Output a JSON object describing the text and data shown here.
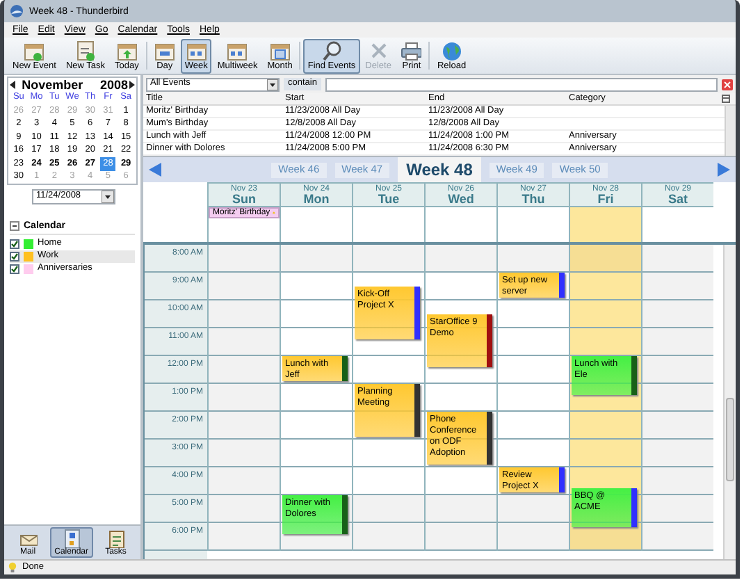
{
  "window": {
    "title": "Week 48 - Thunderbird"
  },
  "menu": [
    "File",
    "Edit",
    "View",
    "Go",
    "Calendar",
    "Tools",
    "Help"
  ],
  "toolbar": [
    {
      "label": "New Event",
      "selected": false,
      "disabled": false
    },
    {
      "label": "New Task",
      "selected": false,
      "disabled": false
    },
    {
      "label": "Today",
      "selected": false,
      "disabled": false
    },
    {
      "label": "Day",
      "selected": false,
      "disabled": false
    },
    {
      "label": "Week",
      "selected": true,
      "disabled": false
    },
    {
      "label": "Multiweek",
      "selected": false,
      "disabled": false
    },
    {
      "label": "Month",
      "selected": false,
      "disabled": false
    },
    {
      "label": "Find Events",
      "selected": true,
      "disabled": false
    },
    {
      "label": "Delete",
      "selected": false,
      "disabled": true
    },
    {
      "label": "Print",
      "selected": false,
      "disabled": false
    },
    {
      "label": "Reload",
      "selected": false,
      "disabled": false
    }
  ],
  "mini_calendar": {
    "month": "November",
    "year": "2008",
    "weekdays": [
      "Su",
      "Mo",
      "Tu",
      "We",
      "Th",
      "Fr",
      "Sa"
    ],
    "days": [
      {
        "label": "26",
        "other": true,
        "bold": false,
        "selected": false
      },
      {
        "label": "27",
        "other": true,
        "bold": false,
        "selected": false
      },
      {
        "label": "28",
        "other": true,
        "bold": false,
        "selected": false
      },
      {
        "label": "29",
        "other": true,
        "bold": false,
        "selected": false
      },
      {
        "label": "30",
        "other": true,
        "bold": false,
        "selected": false
      },
      {
        "label": "31",
        "other": true,
        "bold": false,
        "selected": false
      },
      {
        "label": "1",
        "other": false,
        "bold": false,
        "selected": false
      },
      {
        "label": "2",
        "other": false,
        "bold": false,
        "selected": false
      },
      {
        "label": "3",
        "other": false,
        "bold": false,
        "selected": false
      },
      {
        "label": "4",
        "other": false,
        "bold": false,
        "selected": false
      },
      {
        "label": "5",
        "other": false,
        "bold": false,
        "selected": false
      },
      {
        "label": "6",
        "other": false,
        "bold": false,
        "selected": false
      },
      {
        "label": "7",
        "other": false,
        "bold": false,
        "selected": false
      },
      {
        "label": "8",
        "other": false,
        "bold": false,
        "selected": false
      },
      {
        "label": "9",
        "other": false,
        "bold": false,
        "selected": false
      },
      {
        "label": "10",
        "other": false,
        "bold": false,
        "selected": false
      },
      {
        "label": "11",
        "other": false,
        "bold": false,
        "selected": false
      },
      {
        "label": "12",
        "other": false,
        "bold": false,
        "selected": false
      },
      {
        "label": "13",
        "other": false,
        "bold": false,
        "selected": false
      },
      {
        "label": "14",
        "other": false,
        "bold": false,
        "selected": false
      },
      {
        "label": "15",
        "other": false,
        "bold": false,
        "selected": false
      },
      {
        "label": "16",
        "other": false,
        "bold": false,
        "selected": false
      },
      {
        "label": "17",
        "other": false,
        "bold": false,
        "selected": false
      },
      {
        "label": "18",
        "other": false,
        "bold": false,
        "selected": false
      },
      {
        "label": "19",
        "other": false,
        "bold": false,
        "selected": false
      },
      {
        "label": "20",
        "other": false,
        "bold": false,
        "selected": false
      },
      {
        "label": "21",
        "other": false,
        "bold": false,
        "selected": false
      },
      {
        "label": "22",
        "other": false,
        "bold": false,
        "selected": false
      },
      {
        "label": "23",
        "other": false,
        "bold": false,
        "selected": false
      },
      {
        "label": "24",
        "other": false,
        "bold": true,
        "selected": false
      },
      {
        "label": "25",
        "other": false,
        "bold": true,
        "selected": false
      },
      {
        "label": "26",
        "other": false,
        "bold": true,
        "selected": false
      },
      {
        "label": "27",
        "other": false,
        "bold": true,
        "selected": false
      },
      {
        "label": "28",
        "other": false,
        "bold": false,
        "selected": true
      },
      {
        "label": "29",
        "other": false,
        "bold": true,
        "selected": false
      },
      {
        "label": "30",
        "other": false,
        "bold": false,
        "selected": false
      },
      {
        "label": "1",
        "other": true,
        "bold": false,
        "selected": false
      },
      {
        "label": "2",
        "other": true,
        "bold": false,
        "selected": false
      },
      {
        "label": "3",
        "other": true,
        "bold": false,
        "selected": false
      },
      {
        "label": "4",
        "other": true,
        "bold": false,
        "selected": false
      },
      {
        "label": "5",
        "other": true,
        "bold": false,
        "selected": false
      },
      {
        "label": "6",
        "other": true,
        "bold": false,
        "selected": false
      }
    ]
  },
  "date_field": {
    "value": "11/24/2008"
  },
  "calendars": {
    "title": "Calendar",
    "expanded": true,
    "items": [
      {
        "name": "Home",
        "color": "#33ee33",
        "checked": true,
        "selected": false
      },
      {
        "name": "Work",
        "color": "#ffc020",
        "checked": true,
        "selected": true
      },
      {
        "name": "Anniversaries",
        "color": "#ffccee",
        "checked": true,
        "selected": false
      }
    ]
  },
  "modes": [
    {
      "label": "Mail",
      "selected": false
    },
    {
      "label": "Calendar",
      "selected": true
    },
    {
      "label": "Tasks",
      "selected": false
    }
  ],
  "filter": {
    "value": "All Events",
    "label": "contain"
  },
  "event_list": {
    "columns": [
      "Title",
      "Start",
      "End",
      "Category"
    ],
    "rows": [
      [
        "Moritz' Birthday",
        "11/23/2008 All Day",
        "11/23/2008 All Day",
        ""
      ],
      [
        "Mum's Birthday",
        "12/8/2008 All Day",
        "12/8/2008 All Day",
        ""
      ],
      [
        "Lunch with Jeff",
        "11/24/2008 12:00 PM",
        "11/24/2008 1:00 PM",
        "Anniversary"
      ],
      [
        "Dinner with Dolores",
        "11/24/2008 5:00 PM",
        "11/24/2008 6:30 PM",
        "Anniversary"
      ]
    ]
  },
  "weeks": [
    {
      "label": "Week 46",
      "selected": false
    },
    {
      "label": "Week 47",
      "selected": false
    },
    {
      "label": "Week 48",
      "selected": true
    },
    {
      "label": "Week 49",
      "selected": false
    },
    {
      "label": "Week 50",
      "selected": false
    }
  ],
  "days": [
    {
      "date": "Nov 23",
      "name": "Sun",
      "weekend": true,
      "today": false,
      "all_day": [
        {
          "title": "Moritz' Birthday",
          "color": "#f4ccf0",
          "alarm": true
        }
      ]
    },
    {
      "date": "Nov 24",
      "name": "Mon",
      "weekend": false,
      "today": false
    },
    {
      "date": "Nov 25",
      "name": "Tue",
      "weekend": false,
      "today": false
    },
    {
      "date": "Nov 26",
      "name": "Wed",
      "weekend": false,
      "today": false
    },
    {
      "date": "Nov 27",
      "name": "Thu",
      "weekend": false,
      "today": false
    },
    {
      "date": "Nov 28",
      "name": "Fri",
      "weekend": false,
      "today": true
    },
    {
      "date": "Nov 29",
      "name": "Sat",
      "weekend": true,
      "today": false
    }
  ],
  "hours": [
    "8:00 AM",
    "9:00 AM",
    "10:00 AM",
    "11:00 AM",
    "12:00 PM",
    "1:00 PM",
    "2:00 PM",
    "3:00 PM",
    "4:00 PM",
    "5:00 PM",
    "6:00 PM"
  ],
  "events": [
    {
      "title": "Set up new server",
      "color": "#ffc830"
    },
    {
      "title": "Kick-Off Project X",
      "color": "#ffc830"
    },
    {
      "title": "StarOffice 9 Demo",
      "color": "#ffc830"
    },
    {
      "title": "Lunch with Jeff",
      "color": "#ffc830"
    },
    {
      "title": "Lunch with Ele",
      "color": "#44f044"
    },
    {
      "title": "Planning Meeting",
      "color": "#ffc830"
    },
    {
      "title": "Phone Conference on ODF Adoption",
      "color": "#ffc830"
    },
    {
      "title": "Review Project X",
      "color": "#ffc830"
    },
    {
      "title": "BBQ @ ACME",
      "color": "#44f044"
    },
    {
      "title": "Dinner with Dolores",
      "color": "#44f044"
    }
  ],
  "status_bar": {
    "text": "Done"
  }
}
